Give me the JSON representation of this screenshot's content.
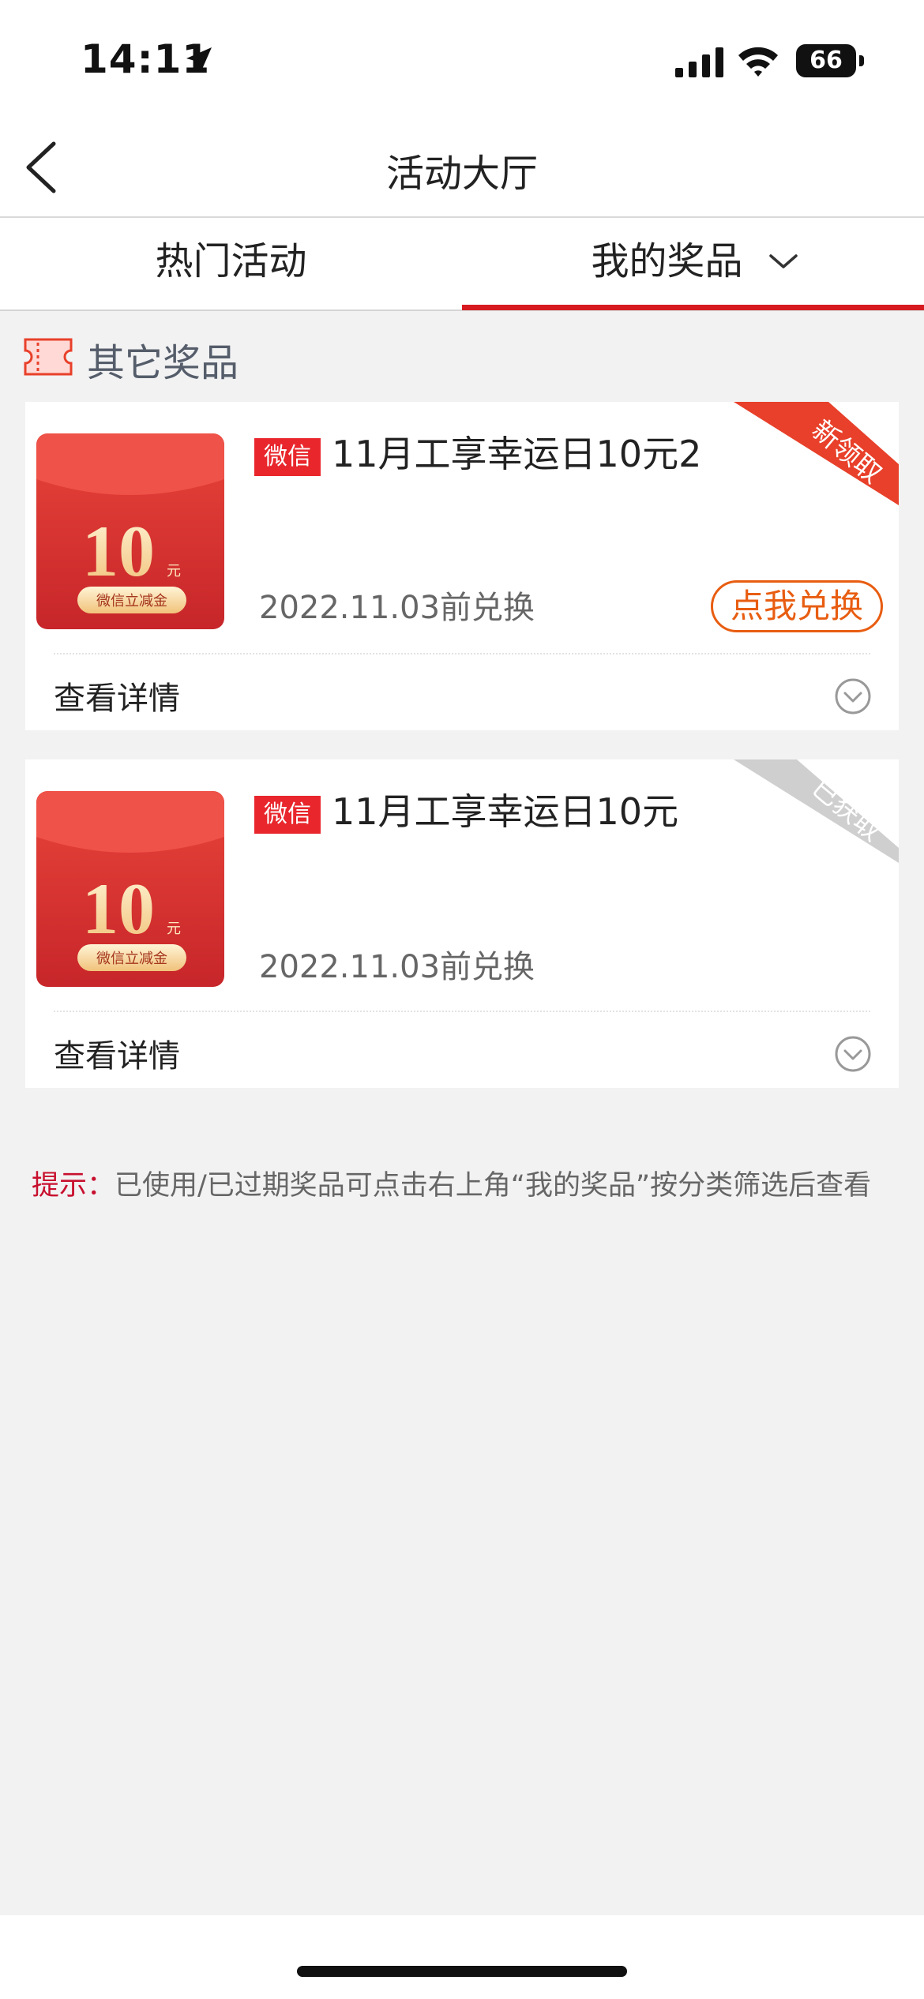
{
  "status_bar": {
    "time": "14:11",
    "battery": "66"
  },
  "nav": {
    "title": "活动大厅",
    "back_icon": "chevron-left-icon"
  },
  "tabs": [
    {
      "label": "热门活动",
      "active": false
    },
    {
      "label": "我的奖品",
      "active": true,
      "icon": "chevron-down-icon"
    }
  ],
  "section": {
    "title": "其它奖品",
    "icon": "ticket-icon"
  },
  "prizes": [
    {
      "source_badge": "微信",
      "title": "11月工享幸运日10元2",
      "expire": "2022.11.03前兑换",
      "action_label": "点我兑换",
      "corner_label": "新领取",
      "details_label": "查看详情",
      "envelope_amount": "10",
      "envelope_unit": "元",
      "envelope_caption": "微信立减金"
    },
    {
      "source_badge": "微信",
      "title": "11月工享幸运日10元",
      "expire": "2022.11.03前兑换",
      "corner_label": "已获取",
      "details_label": "查看详情",
      "envelope_amount": "10",
      "envelope_unit": "元",
      "envelope_caption": "微信立减金"
    }
  ],
  "tip": {
    "label": "提示：",
    "text": "已使用/已过期奖品可点击右上角“我的奖品”按分类筛选后查看"
  },
  "colors": {
    "brand_red": "#d71a20",
    "action_orange": "#e85d11",
    "corner_new": "#e8402a",
    "corner_obtained": "#cfcfcf",
    "background": "#f2f2f3"
  }
}
